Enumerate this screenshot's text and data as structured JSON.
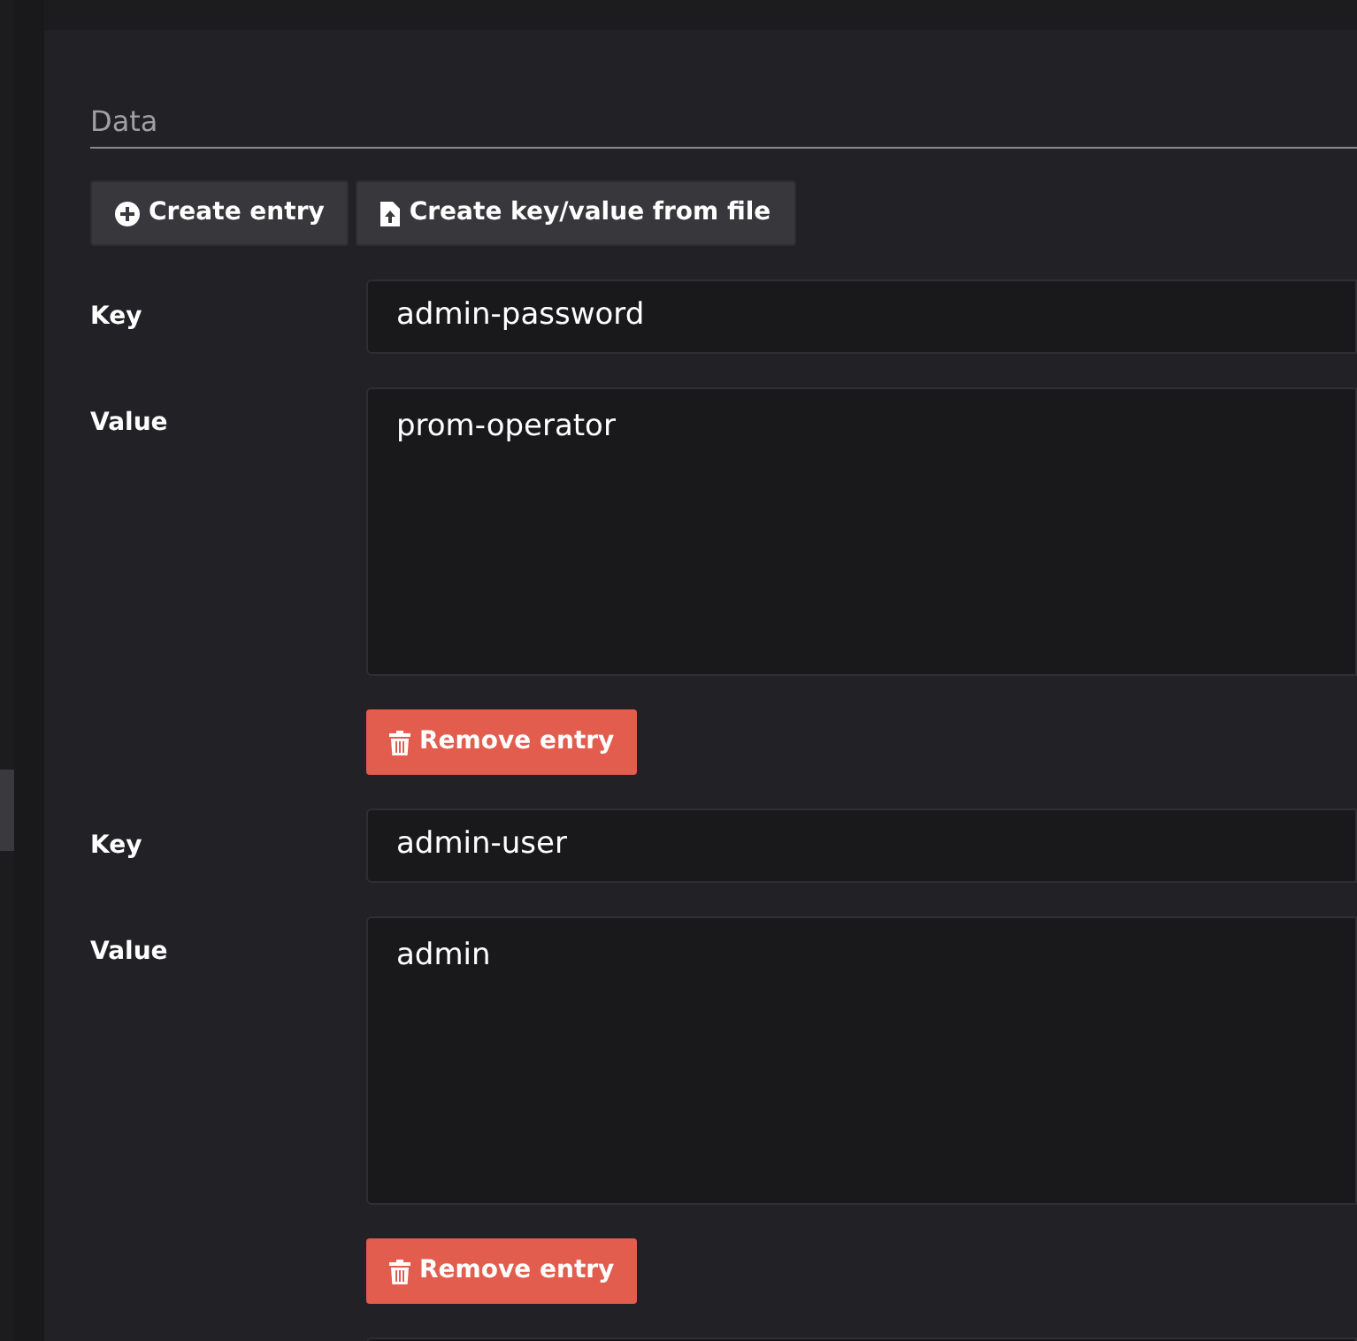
{
  "section": {
    "title": "Data"
  },
  "actions": [
    {
      "label": "Create entry",
      "kind": "create"
    },
    {
      "label": "Create key/value from file",
      "kind": "file"
    }
  ],
  "entries": [
    {
      "key_label": "Key",
      "key": "admin-password",
      "value_label": "Value",
      "value": "prom-operator",
      "remove": "Remove entry"
    },
    {
      "key_label": "Key",
      "key": "admin-user",
      "value_label": "Value",
      "value": "admin",
      "remove": "Remove entry"
    }
  ]
}
